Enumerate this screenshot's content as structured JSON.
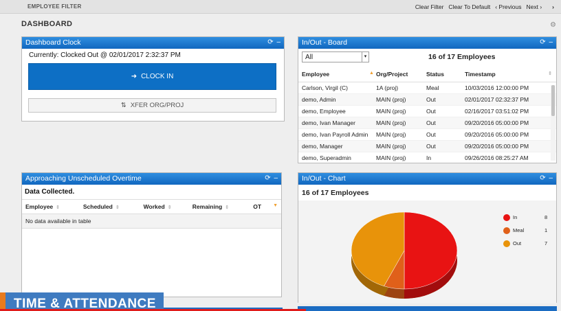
{
  "filter_bar": {
    "title": "EMPLOYEE FILTER",
    "clear_filter": "Clear Filter",
    "clear_default": "Clear To Default",
    "previous": "‹ Previous",
    "next": "Next ›",
    "expand": "›"
  },
  "page": {
    "title": "DASHBOARD",
    "settings_icon": "gear-icon"
  },
  "clock_panel": {
    "title": "Dashboard Clock",
    "controls": "⟳ ‒",
    "status": "Currently: Clocked Out @ 02/01/2017 2:32:37 PM",
    "clock_in_label": "CLOCK IN",
    "xfer_label": "XFER ORG/PROJ"
  },
  "board_panel": {
    "title": "In/Out - Board",
    "controls": "⟳ ‒",
    "filter_value": "All",
    "count": "16 of 17 Employees",
    "columns": [
      "Employee",
      "Org/Project",
      "Status",
      "Timestamp"
    ],
    "rows": [
      [
        "Carlson, Virgil (C)",
        "1A (proj)",
        "Meal",
        "10/03/2016 12:00:00 PM"
      ],
      [
        "demo, Admin",
        "MAIN (proj)",
        "Out",
        "02/01/2017 02:32:37 PM"
      ],
      [
        "demo, Employee",
        "MAIN (proj)",
        "Out",
        "02/16/2017 03:51:02 PM"
      ],
      [
        "demo, Ivan Manager",
        "MAIN (proj)",
        "Out",
        "09/20/2016 05:00:00 PM"
      ],
      [
        "demo, Ivan Payroll Admin",
        "MAIN (proj)",
        "Out",
        "09/20/2016 05:00:00 PM"
      ],
      [
        "demo, Manager",
        "MAIN (proj)",
        "Out",
        "09/20/2016 05:00:00 PM"
      ],
      [
        "demo, Superadmin",
        "MAIN (proj)",
        "In",
        "09/26/2016 08:25:27 AM"
      ]
    ]
  },
  "ot_panel": {
    "title": "Approaching Unscheduled Overtime",
    "controls": "⟳ ‒",
    "subtitle": "Data Collected.",
    "columns": [
      "Employee",
      "Scheduled",
      "Worked",
      "Remaining",
      "OT"
    ],
    "empty_message": "No data available in table"
  },
  "chart_panel": {
    "title": "In/Out - Chart",
    "controls": "⟳ ‒",
    "count": "16 of 17 Employees"
  },
  "chart_data": {
    "type": "pie",
    "categories": [
      "In",
      "Meal",
      "Out"
    ],
    "values": [
      8,
      1,
      7
    ],
    "colors": [
      "#e81313",
      "#e0601a",
      "#e8930a"
    ]
  },
  "banner": {
    "text": "TIME & ATTENDANCE"
  },
  "colors": {
    "header_blue": "#1b74cf",
    "accent_orange": "#e87b1e"
  }
}
